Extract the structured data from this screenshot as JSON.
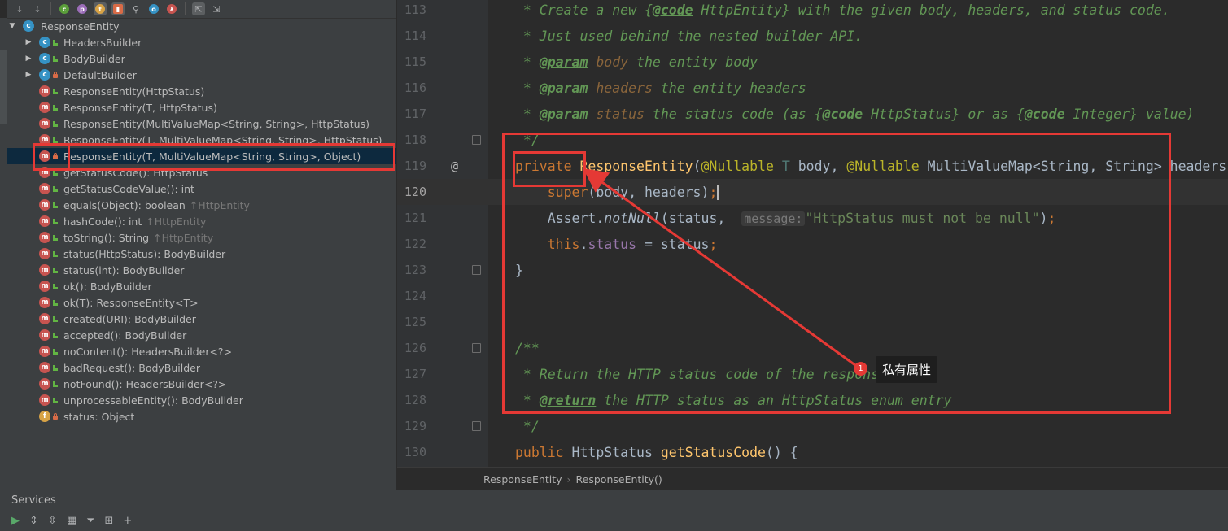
{
  "structure": {
    "root": "ResponseEntity",
    "items": [
      {
        "label": "HeadersBuilder",
        "kind": "c",
        "vis": "pub",
        "arrow": true
      },
      {
        "label": "BodyBuilder",
        "kind": "c",
        "vis": "pub",
        "arrow": true
      },
      {
        "label": "DefaultBuilder",
        "kind": "c",
        "vis": "lock",
        "arrow": true
      },
      {
        "label": "ResponseEntity(HttpStatus)",
        "kind": "m",
        "vis": "pub"
      },
      {
        "label": "ResponseEntity(T, HttpStatus)",
        "kind": "m",
        "vis": "pub"
      },
      {
        "label": "ResponseEntity(MultiValueMap<String, String>, HttpStatus)",
        "kind": "m",
        "vis": "pub"
      },
      {
        "label": "ResponseEntity(T, MultiValueMap<String, String>, HttpStatus)",
        "kind": "m",
        "vis": "pub"
      },
      {
        "label": "ResponseEntity(T, MultiValueMap<String, String>, Object)",
        "kind": "m",
        "vis": "lock",
        "selected": true
      },
      {
        "label": "getStatusCode(): HttpStatus",
        "kind": "m",
        "vis": "pub"
      },
      {
        "label": "getStatusCodeValue(): int",
        "kind": "m",
        "vis": "pub"
      },
      {
        "label": "equals(Object): boolean",
        "kind": "m",
        "vis": "pub",
        "inherit": "↑HttpEntity"
      },
      {
        "label": "hashCode(): int",
        "kind": "m",
        "vis": "pub",
        "inherit": "↑HttpEntity"
      },
      {
        "label": "toString(): String",
        "kind": "m",
        "vis": "pub",
        "inherit": "↑HttpEntity"
      },
      {
        "label": "status(HttpStatus): BodyBuilder",
        "kind": "m",
        "vis": "pub"
      },
      {
        "label": "status(int): BodyBuilder",
        "kind": "m",
        "vis": "pub"
      },
      {
        "label": "ok(): BodyBuilder",
        "kind": "m",
        "vis": "pub"
      },
      {
        "label": "ok(T): ResponseEntity<T>",
        "kind": "m",
        "vis": "pub"
      },
      {
        "label": "created(URI): BodyBuilder",
        "kind": "m",
        "vis": "pub"
      },
      {
        "label": "accepted(): BodyBuilder",
        "kind": "m",
        "vis": "pub"
      },
      {
        "label": "noContent(): HeadersBuilder<?>",
        "kind": "m",
        "vis": "pub"
      },
      {
        "label": "badRequest(): BodyBuilder",
        "kind": "m",
        "vis": "pub"
      },
      {
        "label": "notFound(): HeadersBuilder<?>",
        "kind": "m",
        "vis": "pub"
      },
      {
        "label": "unprocessableEntity(): BodyBuilder",
        "kind": "m",
        "vis": "pub"
      },
      {
        "label": "status: Object",
        "kind": "f",
        "vis": "lock"
      }
    ]
  },
  "editor": {
    "lines": [
      {
        "n": "113",
        "html": "<span class='cmt'> * Create a new </span><span class='cmt'>{</span><span class='tag2'>@code</span><span class='cmt'> HttpEntity} with the given body, headers, and status code.</span>"
      },
      {
        "n": "114",
        "html": "<span class='cmt'> * Just used behind the nested builder API.</span>"
      },
      {
        "n": "115",
        "html": "<span class='cmt'> * </span><span class='tag2'>@param</span><span class='tagname'> body</span><span class='cmt'> the entity body</span>"
      },
      {
        "n": "116",
        "html": "<span class='cmt'> * </span><span class='tag2'>@param</span><span class='tagname'> headers</span><span class='cmt'> the entity headers</span>"
      },
      {
        "n": "117",
        "html": "<span class='cmt'> * </span><span class='tag2'>@param</span><span class='tagname'> status</span><span class='cmt'> the status code (as {</span><span class='tag2'>@code</span><span class='cmt'> HttpStatus} or as {</span><span class='tag2'>@code</span><span class='cmt'> Integer} value)</span>"
      },
      {
        "n": "118",
        "html": "<span class='cmt'> */</span>",
        "fold": true
      },
      {
        "n": "119",
        "html": "<span class='kw'>private</span> <span class='mth'>ResponseEntity</span><span class='plain'>(</span><span class='ann'>@Nullable</span> <span class='tp'>T</span><span class='plain'> body, </span><span class='ann'>@Nullable</span><span class='plain'> MultiValueMap&lt;String, String&gt; headers, Object status) {</span>",
        "mark": "@"
      },
      {
        "n": "120",
        "html": "    <span class='kw'>super</span><span class='plain'>(body, headers)</span><span class='kw'>;</span><span class='caret'></span>",
        "current": true
      },
      {
        "n": "121",
        "html": "    <span class='plain'>Assert.</span><span class='plain italicm'>notNull</span><span class='plain'>(status, </span> <span class='hint'>message:</span><span class='str'>\"HttpStatus must not be null\"</span><span class='plain'>)</span><span class='kw'>;</span>"
      },
      {
        "n": "122",
        "html": "    <span class='kw'>this</span><span class='plain'>.</span><span class='fld'>status</span><span class='plain'> = status</span><span class='kw'>;</span>"
      },
      {
        "n": "123",
        "html": "<span class='plain'>}</span>",
        "fold": true
      },
      {
        "n": "124",
        "html": ""
      },
      {
        "n": "125",
        "html": ""
      },
      {
        "n": "126",
        "html": "<span class='cmt'>/**</span>",
        "fold": true
      },
      {
        "n": "127",
        "html": "<span class='cmt'> * Return the HTTP status code of the response.</span>"
      },
      {
        "n": "128",
        "html": "<span class='cmt'> * </span><span class='tag2'>@return</span><span class='cmt'> the HTTP status as an HttpStatus enum entry</span>"
      },
      {
        "n": "129",
        "html": "<span class='cmt'> */</span>",
        "fold": true
      },
      {
        "n": "130",
        "html": "<span class='kw'>public</span><span class='plain'> HttpStatus </span><span class='mth'>getStatusCode</span><span class='plain'>() {</span>"
      }
    ]
  },
  "breadcrumb": [
    "ResponseEntity",
    "ResponseEntity()"
  ],
  "services": {
    "title": "Services"
  },
  "annotation": {
    "badge": "1",
    "label": "私有属性"
  }
}
